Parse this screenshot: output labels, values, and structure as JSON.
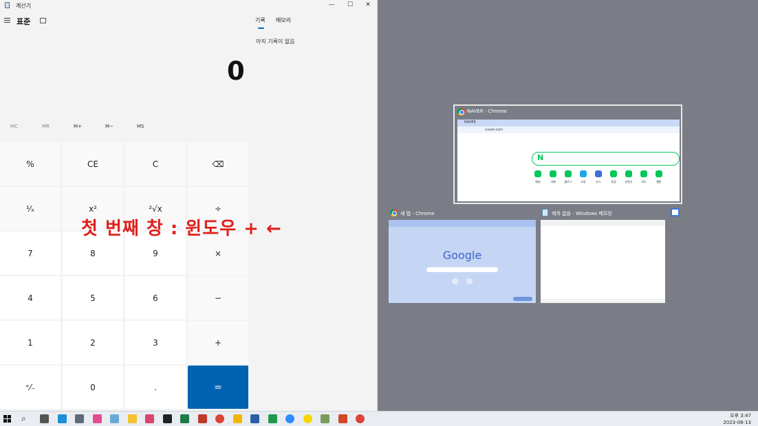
{
  "window": {
    "title": "계산기",
    "controls": [
      "—",
      "☐",
      "✕"
    ]
  },
  "calculator": {
    "mode": "표준",
    "tabs": [
      "기록",
      "메모리"
    ],
    "history_empty": "아직 기록이 없음",
    "display": "0",
    "memory_buttons": [
      "MC",
      "MR",
      "M+",
      "M−",
      "MS"
    ],
    "keys": [
      [
        "%",
        "CE",
        "C",
        "⌫"
      ],
      [
        "¹⁄ₓ",
        "x²",
        "²√x",
        "÷"
      ],
      [
        "7",
        "8",
        "9",
        "×"
      ],
      [
        "4",
        "5",
        "6",
        "−"
      ],
      [
        "1",
        "2",
        "3",
        "+"
      ],
      [
        "⁺⁄₋",
        "0",
        ".",
        "="
      ]
    ]
  },
  "overlay_text": "첫 번째 창 : 윈도우 + ←",
  "snap_assist": {
    "windows": [
      {
        "title": "NAVER - Chrome",
        "url": "naver.com",
        "tab": "NAVER",
        "logo": "N"
      },
      {
        "title": "새 탭 - Chrome",
        "logo": "Google"
      },
      {
        "title": "제목 없음 - Windows 메모장"
      }
    ]
  },
  "naver_icons": [
    "메일",
    "카페",
    "블로그",
    "쇼핑",
    "뉴스",
    "증권",
    "부동산",
    "지도",
    "웹툰"
  ],
  "taskbar": {
    "time": "오후 3:47",
    "date": "2023-06-13"
  },
  "colors": {
    "accent": "#0063b1",
    "overlay": "#e0201c",
    "desktop": "#7a7d86"
  }
}
